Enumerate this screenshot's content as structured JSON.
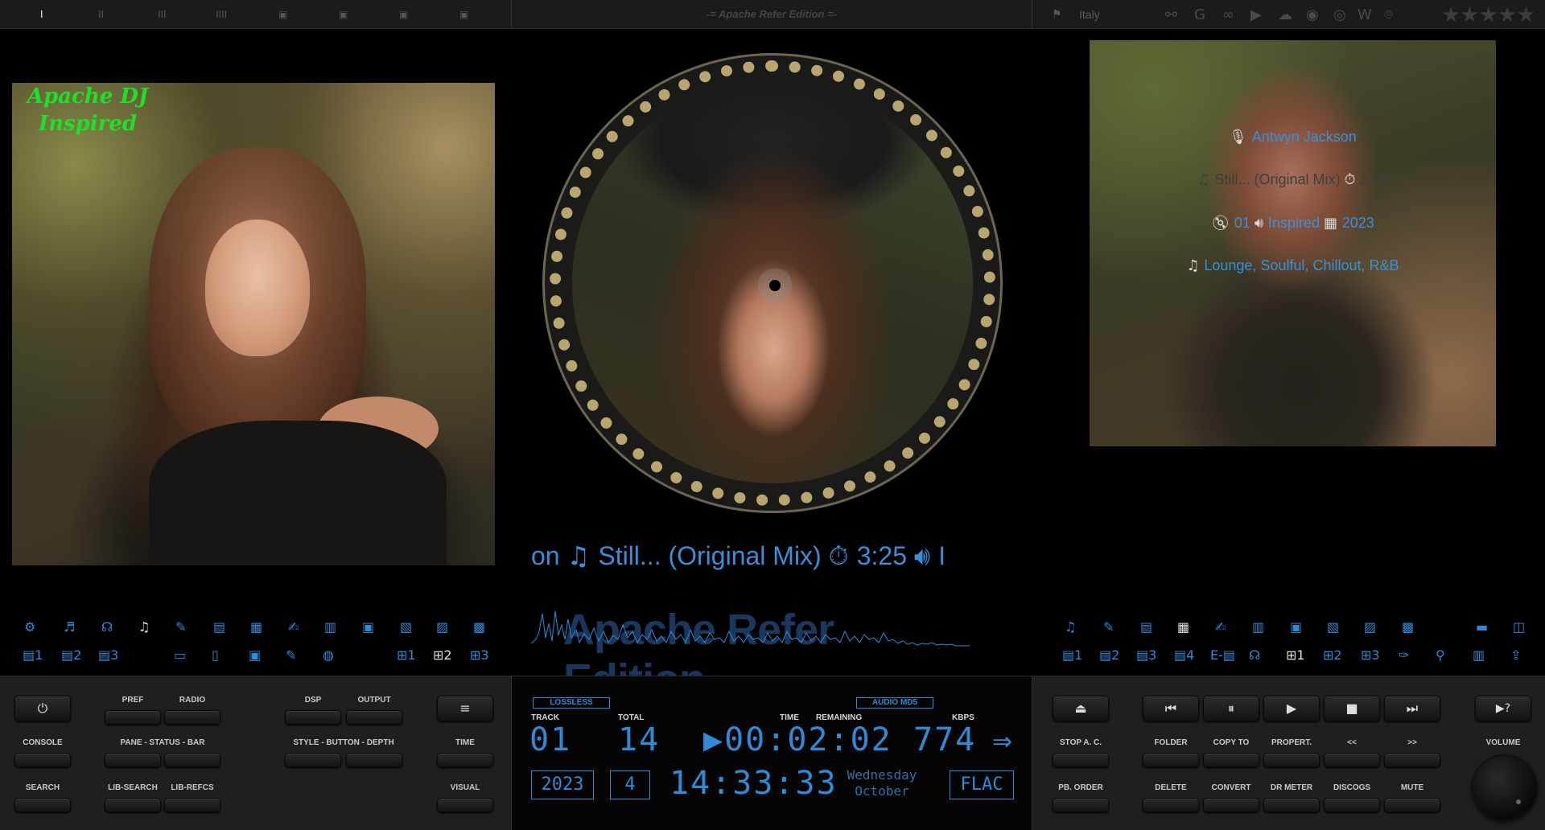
{
  "topbar": {
    "title": "-= Apache Refer Edition =-",
    "layout_ticks": [
      "I",
      "II",
      "III",
      "IIII",
      "▣",
      "▣",
      "▣",
      "▣"
    ],
    "country": "Italy",
    "rating_stars": 0
  },
  "left": {
    "cover_tag_line1": "Apache DJ",
    "cover_tag_line2": "Inspired"
  },
  "center": {
    "ticker": {
      "lead": "on",
      "title": "Still... (Original Mix)",
      "duration": "3:25",
      "tail": "I"
    },
    "waveform_title": "Apache Refer Edition"
  },
  "right": {
    "artist": "Antwyn Jackson",
    "title": "Still... (Original Mix)",
    "time_dim": "3:25",
    "track": "01",
    "album": "Inspired",
    "year": "2023",
    "genres": "Lounge, Soulful, Chillout, R&B"
  },
  "left_icons_row2": {
    "p1": "1",
    "p2": "2",
    "p3": "3",
    "v1": "1",
    "v2": "2",
    "v3": "3"
  },
  "right_icons_row2": {
    "p1": "1",
    "p2": "2",
    "p3": "3",
    "p4": "4",
    "e": "E-",
    "v1": "1",
    "v2": "2",
    "v3": "3"
  },
  "bottom_left": {
    "pref": "PREF",
    "radio": "RADIO",
    "dsp": "DSP",
    "output": "OUTPUT",
    "console": "CONSOLE",
    "pane_status_bar": "PANE - STATUS - BAR",
    "style_button_depth": "STYLE - BUTTON - DEPTH",
    "time": "TIME",
    "search": "SEARCH",
    "lib_search": "LIB-SEARCH",
    "lib_refcs": "LIB-REFCS",
    "visual": "VISUAL"
  },
  "lcd": {
    "lossless": "LOSSLESS",
    "audio_md5": "AUDIO MD5",
    "track_label": "TRACK",
    "total_label": "TOTAL",
    "time_label": "TIME",
    "remaining_label": "REMAINING",
    "kbps_label": "KBPS",
    "track": "01",
    "total": "14",
    "elapsed": "▶00:02:02",
    "kbps": "774",
    "year": "2023",
    "month_num": "4",
    "clock": "14:33:33",
    "weekday": "Wednesday",
    "month": "October",
    "format": "FLAC"
  },
  "bottom_right": {
    "stop_ac": "STOP A. C.",
    "folder": "FOLDER",
    "copy_to": "COPY TO",
    "propert": "PROPERT.",
    "prev": "<<",
    "next": ">>",
    "volume": "VOLUME",
    "pb_order": "PB. ORDER",
    "delete": "DELETE",
    "convert": "CONVERT",
    "dr_meter": "DR METER",
    "discogs": "DISCOGS",
    "mute": "MUTE",
    "help": "▶?"
  },
  "colors": {
    "accent": "#2f8bd8",
    "green_tag": "#1ee02a",
    "panel": "#1f1f1f"
  }
}
